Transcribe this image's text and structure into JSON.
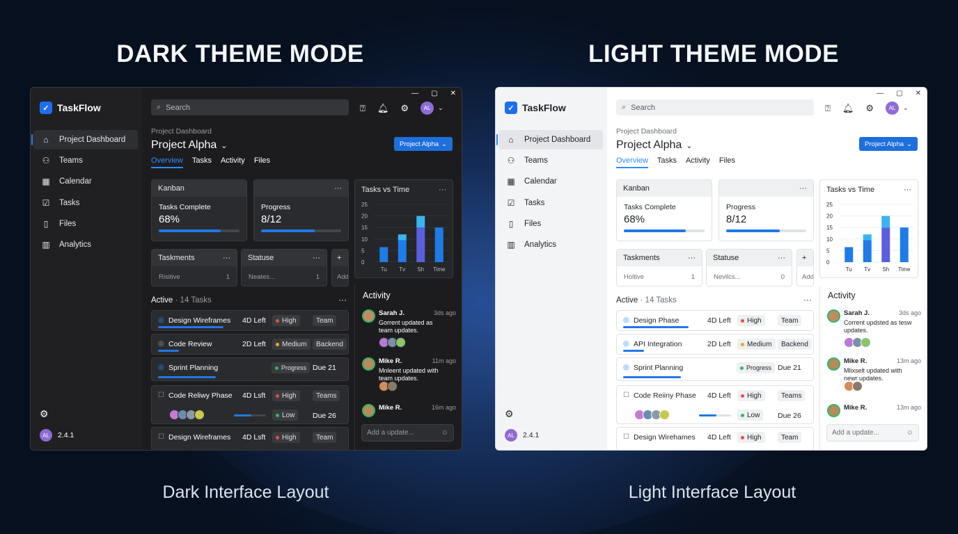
{
  "headings": {
    "dark": "DARK THEME MODE",
    "light": "LIGHT THEME MODE"
  },
  "captions": {
    "dark": "Dark Interface Layout",
    "light": "Light Interface Layout"
  },
  "colors": {
    "accent": "#1e6fdc",
    "bar": "#2278e6",
    "high": "#e84c4c",
    "medium": "#f5a623",
    "low": "#2fb866",
    "progress": "#2fb866"
  },
  "windows": {
    "dark": {
      "app_name": "TaskFlow",
      "nav": [
        "Project Dashboard",
        "Teams",
        "Calendar",
        "Tasks",
        "Files",
        "Analytics"
      ],
      "nav_icons": [
        "home-icon",
        "users-icon",
        "calendar-icon",
        "check-square-icon",
        "file-icon",
        "bar-chart-icon"
      ],
      "version": "2.4.1",
      "avatar_initials": "AL",
      "search_placeholder": "Search",
      "breadcrumb": "Project Dashboard",
      "project_title": "Project Alpha",
      "project_button": "Project Alpha",
      "tabs": [
        "Overview",
        "Tasks",
        "Activity",
        "Files"
      ],
      "kanban": {
        "title": "Kanban",
        "label": "Tasks Complete",
        "value": "68%",
        "progress": 0.77
      },
      "progress_card": {
        "label": "Progress",
        "value": "8/12",
        "progress": 0.67
      },
      "small_cards": [
        {
          "title": "Taskments",
          "text": "Risitive",
          "count": "1"
        },
        {
          "title": "Statuse",
          "text": "Neates...",
          "count": "1"
        },
        {
          "title": "+",
          "text": "Add",
          "count": ""
        }
      ],
      "active_label": "Active",
      "active_count": "· 14 Tasks",
      "tasks": [
        {
          "name": "Design Wireframes",
          "left": "4D Left",
          "badge": "High",
          "tag": "Team",
          "due": "",
          "progress": 0.8
        },
        {
          "name": "Code Review",
          "left": "2D Left",
          "badge": "Medium",
          "tag": "Backend",
          "due": "",
          "progress": 0.25
        },
        {
          "name": "Sprint Planning",
          "left": "",
          "badge": "Progress",
          "tag": "",
          "due": "Due 21",
          "progress": 0.7
        },
        {
          "name": "Code Reliwy Phase",
          "left": "4D Lsft",
          "badge": "High",
          "tag": "Teams",
          "due": "Due 26",
          "badge2": "Low",
          "progress": 0.55
        },
        {
          "name": "Design Wireframes",
          "left": "4D Lsft",
          "badge": "High",
          "tag": "Team",
          "due": "",
          "progress": 0
        }
      ],
      "activity": {
        "title": "Activity",
        "entries": [
          {
            "who": "Sarah J.",
            "when": "3ds ago",
            "msg": "Gorrent updated as team updates."
          },
          {
            "who": "Mike R.",
            "when": "11m ago",
            "msg": "Mnleent updated with team updates."
          },
          {
            "who": "Mike R.",
            "when": "16m ago",
            "msg": ""
          }
        ],
        "add_placeholder": "Add a update..."
      }
    },
    "light": {
      "app_name": "TaskFlow",
      "nav": [
        "Project Dashboard",
        "Teams",
        "Calendar",
        "Tasks",
        "Files",
        "Analytics"
      ],
      "nav_icons": [
        "home-icon",
        "users-icon",
        "calendar-icon",
        "check-square-icon",
        "file-icon",
        "bar-chart-icon"
      ],
      "version": "2.4.1",
      "avatar_initials": "AL",
      "search_placeholder": "Search",
      "breadcrumb": "Project Dashboard",
      "project_title": "Project Alpha",
      "project_button": "Project Alpha",
      "tabs": [
        "Overview",
        "Tasks",
        "Activity",
        "Files"
      ],
      "kanban": {
        "title": "Kanban",
        "label": "Tasks Complete",
        "value": "68%",
        "progress": 0.77
      },
      "progress_card": {
        "label": "Progress",
        "value": "8/12",
        "progress": 0.67
      },
      "small_cards": [
        {
          "title": "Taskments",
          "text": "Holtive",
          "count": "1"
        },
        {
          "title": "Statuse",
          "text": "Nevilcs...",
          "count": "0"
        },
        {
          "title": "+",
          "text": "Add",
          "count": ""
        }
      ],
      "active_label": "Active",
      "active_count": "· 14 Tasks",
      "tasks": [
        {
          "name": "Design Phase",
          "left": "4D Left",
          "badge": "High",
          "tag": "Team",
          "due": "",
          "progress": 0.8
        },
        {
          "name": "API Integration",
          "left": "2D Left",
          "badge": "Medium",
          "tag": "Backend",
          "due": "",
          "progress": 0.25
        },
        {
          "name": "Sprint Planning",
          "left": "",
          "badge": "Progress",
          "tag": "",
          "due": "Due 21",
          "progress": 0.7
        },
        {
          "name": "Code Reiiny Phase",
          "left": "4D Left",
          "badge": "High",
          "tag": "Teams",
          "due": "Due 26",
          "badge2": "Low",
          "progress": 0.55
        },
        {
          "name": "Design Wirehames",
          "left": "4D Left",
          "badge": "High",
          "tag": "Team",
          "due": "",
          "progress": 0
        }
      ],
      "activity": {
        "title": "Activity",
        "entries": [
          {
            "who": "Sarah J.",
            "when": "3ds ago",
            "msg": "Corrent updsted as tesw updates."
          },
          {
            "who": "Mike R.",
            "when": "13m ago",
            "msg": "Mlixselt updated with newr updates."
          },
          {
            "who": "Mike R.",
            "when": "13m ago",
            "msg": ""
          }
        ],
        "add_placeholder": "Add a update..."
      }
    }
  },
  "chart_data": [
    {
      "type": "bar",
      "title": "Tasks vs Time",
      "categories": [
        "Tu",
        "Tv",
        "Sh",
        "Time"
      ],
      "ylim": [
        0,
        25
      ],
      "yticks": [
        0,
        5,
        10,
        15,
        20,
        25
      ],
      "series": [
        {
          "values": [
            6.5,
            9.5,
            15,
            15
          ]
        },
        {
          "values": [
            0,
            2.5,
            5,
            0
          ]
        }
      ],
      "colors": [
        "#1f7be8",
        "#3ab4ef",
        "#5a5fe0"
      ]
    },
    {
      "type": "bar",
      "title": "Tasks vs Time",
      "categories": [
        "Tu",
        "Tv",
        "Sh",
        "Time"
      ],
      "ylim": [
        0,
        25
      ],
      "yticks": [
        0,
        5,
        10,
        15,
        20,
        25
      ],
      "series": [
        {
          "values": [
            6.5,
            9.5,
            15,
            15
          ]
        },
        {
          "values": [
            0,
            2.5,
            5,
            0
          ]
        }
      ],
      "colors": [
        "#1f7be8",
        "#3ab4ef",
        "#5a5fe0"
      ]
    }
  ]
}
